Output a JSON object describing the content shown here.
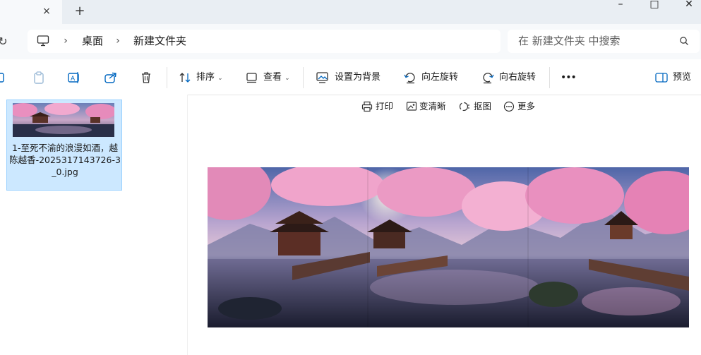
{
  "window": {
    "tab_close": "×",
    "tab_add": "+",
    "minimize": "–",
    "maximize": "□",
    "close": "✕"
  },
  "address": {
    "refresh": "↻",
    "sep": "›",
    "crumbs": [
      "桌面",
      "新建文件夹"
    ]
  },
  "search": {
    "placeholder": "在 新建文件夹 中搜索"
  },
  "commands": {
    "sort": "排序",
    "view": "查看",
    "set_background": "设置为背景",
    "rotate_left": "向左旋转",
    "rotate_right": "向右旋转",
    "more": "•••",
    "preview": "预览",
    "chevron": "⌄"
  },
  "file": {
    "name": "1-至死不渝的浪漫如酒，越陈越香-2025317143726-3_0.jpg"
  },
  "preview_toolbar": {
    "print": "打印",
    "enhance": "变清晰",
    "cutout": "抠图",
    "more": "更多"
  },
  "colors": {
    "accent": "#0067c0",
    "selection": "#cce8ff",
    "selection_border": "#99d1ff"
  }
}
